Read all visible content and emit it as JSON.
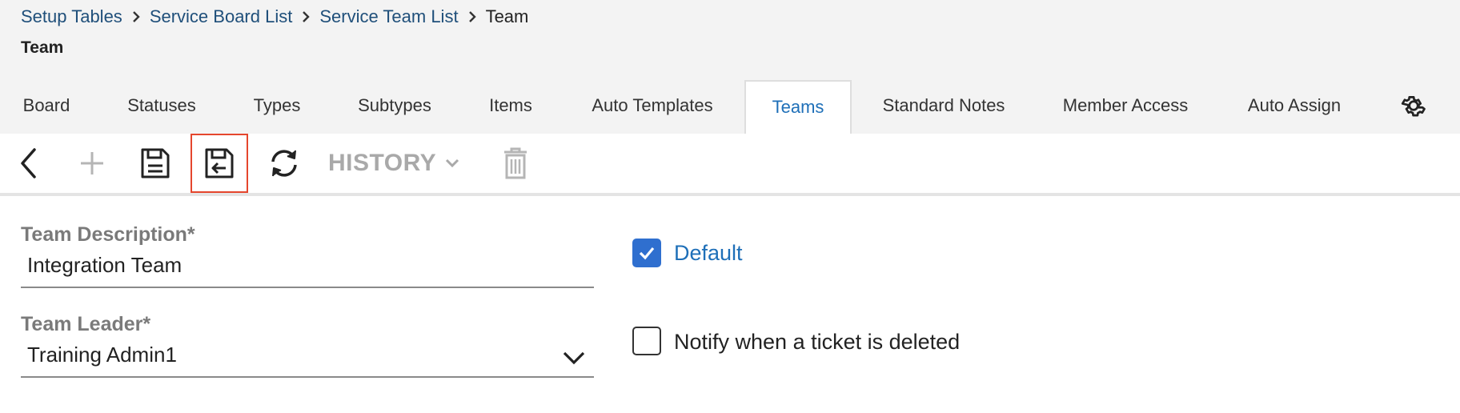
{
  "breadcrumb": {
    "items": [
      {
        "label": "Setup Tables"
      },
      {
        "label": "Service Board List"
      },
      {
        "label": "Service Team List"
      }
    ],
    "current": "Team"
  },
  "page": {
    "title": "Team"
  },
  "tabs": {
    "items": [
      {
        "label": "Board"
      },
      {
        "label": "Statuses"
      },
      {
        "label": "Types"
      },
      {
        "label": "Subtypes"
      },
      {
        "label": "Items"
      },
      {
        "label": "Auto Templates"
      },
      {
        "label": "Teams",
        "active": true
      },
      {
        "label": "Standard Notes"
      },
      {
        "label": "Member Access"
      },
      {
        "label": "Auto Assign"
      }
    ],
    "settings_icon": "gear-icon"
  },
  "toolbar": {
    "back_icon": "chevron-left-icon",
    "add_icon": "plus-icon",
    "save_icon": "save-icon",
    "save_and_close_icon": "save-and-close-icon",
    "refresh_icon": "refresh-icon",
    "history_label": "HISTORY",
    "history_icon": "chevron-down-icon",
    "delete_icon": "trash-icon"
  },
  "form": {
    "team_description": {
      "label": "Team Description*",
      "value": "Integration Team"
    },
    "team_leader": {
      "label": "Team Leader*",
      "value": "Training Admin1"
    },
    "default_checkbox": {
      "label": "Default",
      "checked": true
    },
    "notify_checkbox": {
      "label": "Notify when a ticket is deleted",
      "checked": false
    }
  },
  "colors": {
    "accent": "#1e6fb8",
    "checkbox_fill": "#2f6fcf",
    "breadcrumb_link": "#1f4f7a",
    "highlight_border": "#e5462d",
    "header_bg": "#f3f3f3"
  }
}
